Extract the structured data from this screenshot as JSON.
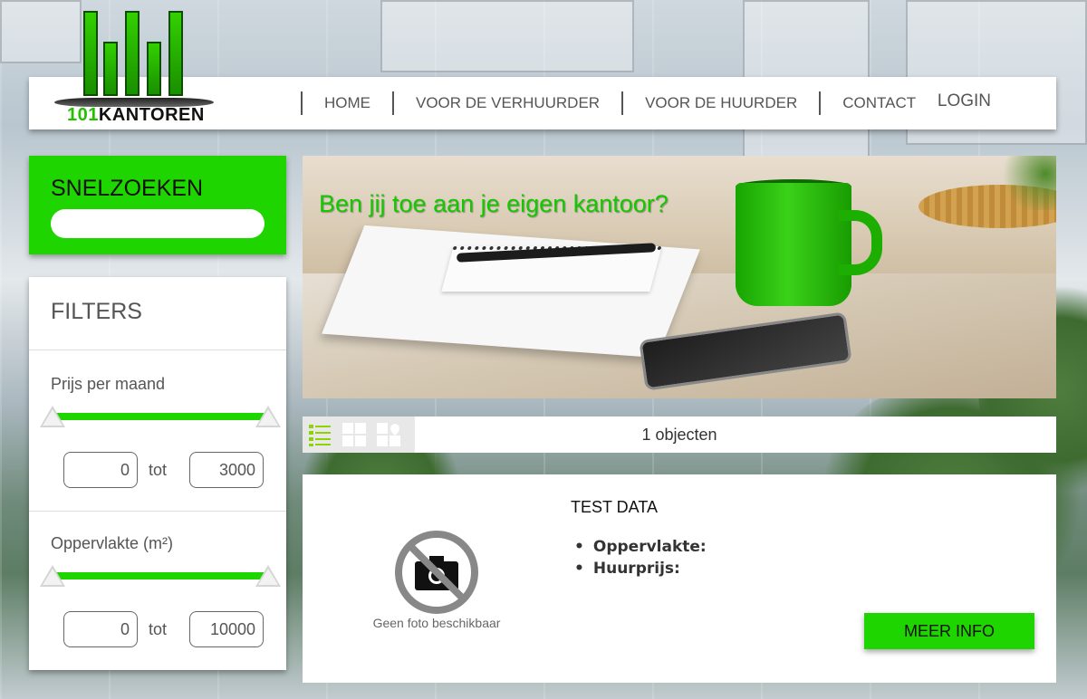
{
  "brand": {
    "logo_number": "101",
    "logo_word": "KANTOREN"
  },
  "nav": {
    "items": [
      {
        "label": "HOME"
      },
      {
        "label": "VOOR DE VERHUURDER"
      },
      {
        "label": "VOOR DE HUURDER"
      },
      {
        "label": "CONTACT"
      }
    ],
    "login": "LOGIN"
  },
  "sidebar": {
    "snelzoeken_title": "SNELZOEKEN",
    "snelzoeken_value": "",
    "filters_title": "FILTERS",
    "price": {
      "label": "Prijs per maand",
      "min": "0",
      "max": "3000",
      "tot": "tot"
    },
    "area": {
      "label": "Oppervlakte (m²)",
      "min": "0",
      "max": "10000",
      "tot": "tot"
    }
  },
  "hero": {
    "headline": "Ben jij toe aan je eigen kantoor?"
  },
  "results": {
    "count_text": "1 objecten",
    "view_icons": [
      "list-view-icon",
      "grid-view-icon",
      "map-view-icon"
    ],
    "items": [
      {
        "title": "TEST DATA",
        "photo_caption": "Geen foto beschikbaar",
        "fields": [
          "Oppervlakte:",
          "Huurprijs:"
        ],
        "button_label": "MEER INFO"
      }
    ]
  },
  "colors": {
    "accent": "#1fd500",
    "text": "#555555"
  }
}
